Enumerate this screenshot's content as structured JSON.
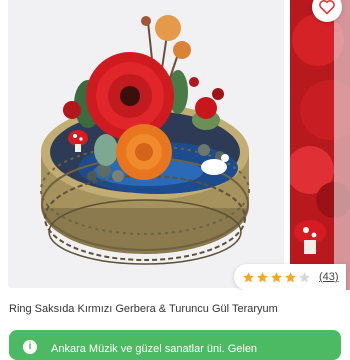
{
  "product": {
    "title": "Ring Saksıda Kırmızı Gerbera & Turuncu Gül Teraryum",
    "image_alt": "Gold ring pot terrarium with red gerbera and orange rose",
    "rating_stars": 4,
    "rating_max": 5,
    "review_count": "(43)"
  },
  "banner": {
    "text": "Ankara Müzik ve güzel sanatlar üni. Gelen"
  },
  "colors": {
    "accent_green": "#4cb963",
    "star": "#f5a623",
    "heart": "#e53935"
  },
  "icons": {
    "favorite": "heart-outline-icon",
    "rating": "star-icon",
    "banner": "info-icon"
  }
}
